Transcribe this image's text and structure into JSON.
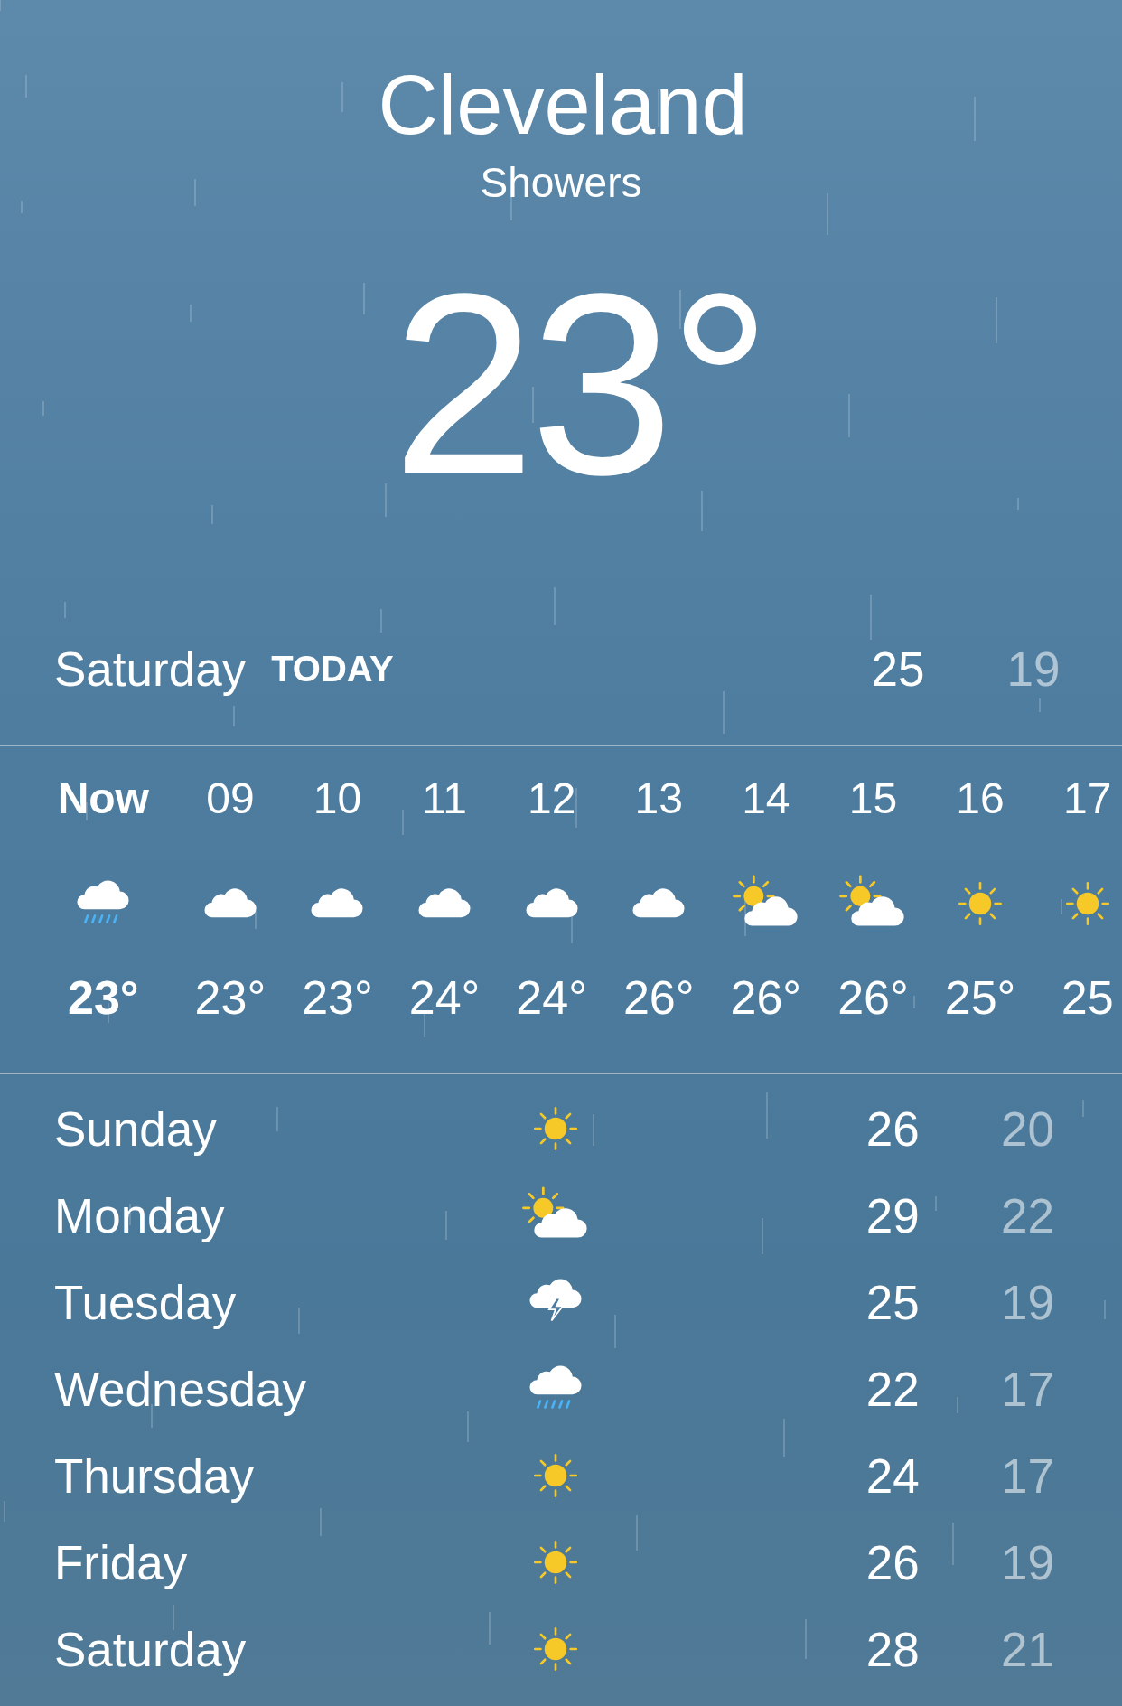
{
  "header": {
    "city": "Cleveland",
    "condition": "Showers",
    "temperature": "23°"
  },
  "today": {
    "day": "Saturday",
    "tag": "TODAY",
    "high": "25",
    "low": "19"
  },
  "hourly": [
    {
      "time": "Now",
      "kind": "rain",
      "temp": "23°",
      "selected": true
    },
    {
      "time": "09",
      "kind": "cloud",
      "temp": "23°",
      "selected": false
    },
    {
      "time": "10",
      "kind": "cloud",
      "temp": "23°",
      "selected": false
    },
    {
      "time": "11",
      "kind": "cloud",
      "temp": "24°",
      "selected": false
    },
    {
      "time": "12",
      "kind": "cloud",
      "temp": "24°",
      "selected": false
    },
    {
      "time": "13",
      "kind": "cloud",
      "temp": "26°",
      "selected": false
    },
    {
      "time": "14",
      "kind": "partly",
      "temp": "26°",
      "selected": false
    },
    {
      "time": "15",
      "kind": "partly",
      "temp": "26°",
      "selected": false
    },
    {
      "time": "16",
      "kind": "sun",
      "temp": "25°",
      "selected": false
    },
    {
      "time": "17",
      "kind": "sun",
      "temp": "25",
      "selected": false
    }
  ],
  "daily": [
    {
      "day": "Sunday",
      "kind": "sun",
      "high": "26",
      "low": "20"
    },
    {
      "day": "Monday",
      "kind": "partly",
      "high": "29",
      "low": "22"
    },
    {
      "day": "Tuesday",
      "kind": "storm",
      "high": "25",
      "low": "19"
    },
    {
      "day": "Wednesday",
      "kind": "rain",
      "high": "22",
      "low": "17"
    },
    {
      "day": "Thursday",
      "kind": "sun",
      "high": "24",
      "low": "17"
    },
    {
      "day": "Friday",
      "kind": "sun",
      "high": "26",
      "low": "19"
    },
    {
      "day": "Saturday",
      "kind": "sun",
      "high": "28",
      "low": "21"
    }
  ]
}
